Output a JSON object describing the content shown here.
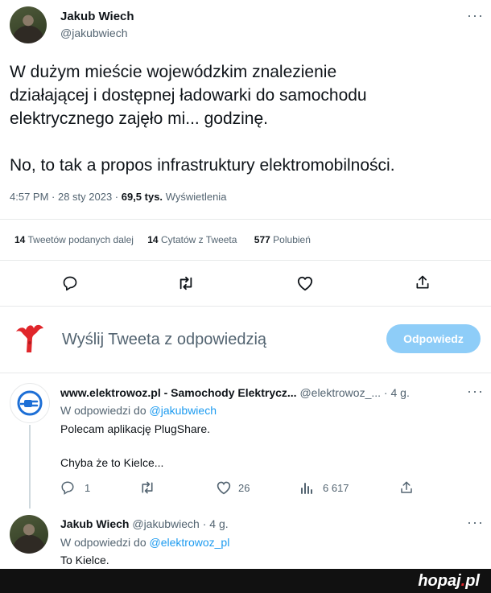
{
  "tweet": {
    "author_name": "Jakub Wiech",
    "author_handle": "@jakubwiech",
    "more": "···",
    "text_line1": "W dużym mieście wojewódzkim znalezienie",
    "text_line2": "działającej i dostępnej ładowarki do samochodu",
    "text_line3": "elektrycznego zajęło mi... godzinę.",
    "text_line4": "No, to tak a propos infrastruktury elektromobilności.",
    "time": "4:57 PM · 28 sty 2023 · ",
    "views_count": "69,5 tys.",
    "views_label": "Wyświetlenia",
    "retweets_count": "14",
    "retweets_label": "Tweetów podanych dalej",
    "quotes_count": "14",
    "quotes_label": "Cytatów z Tweeta",
    "likes_count": "577",
    "likes_label": "Polubień"
  },
  "compose": {
    "placeholder": "Wyślij Tweeta z odpowiedzią",
    "reply_button": "Odpowiedz"
  },
  "reply1": {
    "author_name": "www.elektrowoz.pl - Samochody Elektrycz...",
    "handle_time": "@elektrowoz_... · 4 g.",
    "more": "···",
    "reply_to_prefix": "W odpowiedzi do ",
    "reply_to_handle": "@jakubwiech",
    "line1": "Polecam aplikację PlugShare.",
    "line2": "Chyba że to Kielce...",
    "replies": "1",
    "likes": "26",
    "views": "6 617"
  },
  "reply2": {
    "author_name": "Jakub Wiech",
    "handle_time": "@jakubwiech · 4 g.",
    "more": "···",
    "reply_to_prefix": "W odpowiedzi do ",
    "reply_to_handle": "@elektrowoz_pl",
    "line1": "To Kielce."
  },
  "watermark": {
    "brand": "hopaj",
    "dot": ".",
    "tld": "pl"
  },
  "colors": {
    "accent": "#1d9bf0",
    "reply_button_bg": "#8ecdf8",
    "muted": "#536471",
    "footer_bg": "#111111"
  }
}
